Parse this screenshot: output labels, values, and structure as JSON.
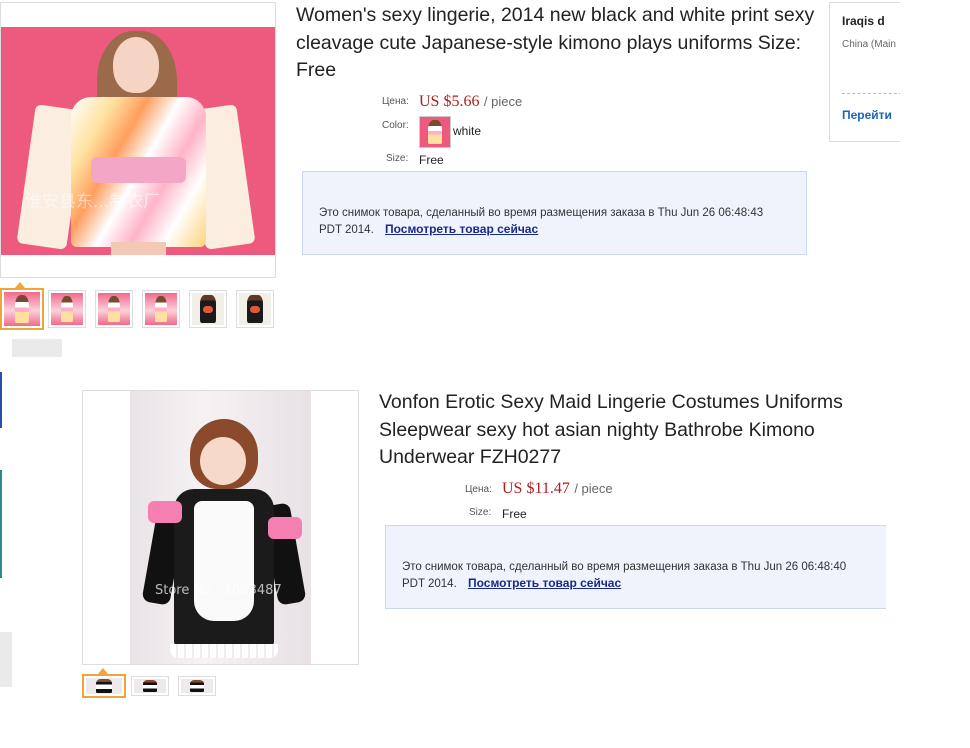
{
  "products": [
    {
      "title": "Women's sexy lingerie, 2014 new black and white print sexy cleavage cute Japanese-style kimono plays uniforms Size: Free",
      "price_label": "Цена:",
      "price": "US $5.66",
      "unit": "/ piece",
      "color_label": "Color:",
      "color_value": "white",
      "size_label": "Size:",
      "size_value": "Free",
      "watermark": "淮安县东...制衣厂",
      "snapshot_text": "Это снимок товара, сделанный во время размещения заказа в Thu Jun 26 06:48:43 PDT 2014.",
      "snapshot_link": "Посмотреть товар сейчас",
      "thumbnails": [
        "kimono-pink",
        "kimono-pink",
        "kimono-pink",
        "kimono-pink",
        "kimono-dark",
        "kimono-dark"
      ]
    },
    {
      "title": "Vonfon Erotic Sexy Maid Lingerie Costumes Uniforms Sleepwear sexy hot asian nighty Bathrobe Kimono Underwear FZH0277",
      "price_label": "Цена:",
      "price": "US $11.47",
      "unit": "/ piece",
      "size_label": "Size:",
      "size_value": "Free",
      "watermark": "Store No : 1083487",
      "snapshot_text": "Это снимок товара, сделанный во время размещения заказа в Thu Jun 26 06:48:40 PDT 2014.",
      "snapshot_link": "Посмотреть товар сейчас",
      "thumbnails": [
        "maid",
        "maid",
        "maid"
      ]
    }
  ],
  "seller": {
    "name": "Iraqis d",
    "location": "China (Main",
    "link": "Перейти"
  },
  "colors": {
    "price": "#b01d1d",
    "link": "#1a2a8a",
    "thumb_active_border": "#f0a53a",
    "snapshot_bg": "#eef3fc",
    "left_accent_blue": "#2a4ea8",
    "left_accent_teal": "#2a8a8a"
  }
}
